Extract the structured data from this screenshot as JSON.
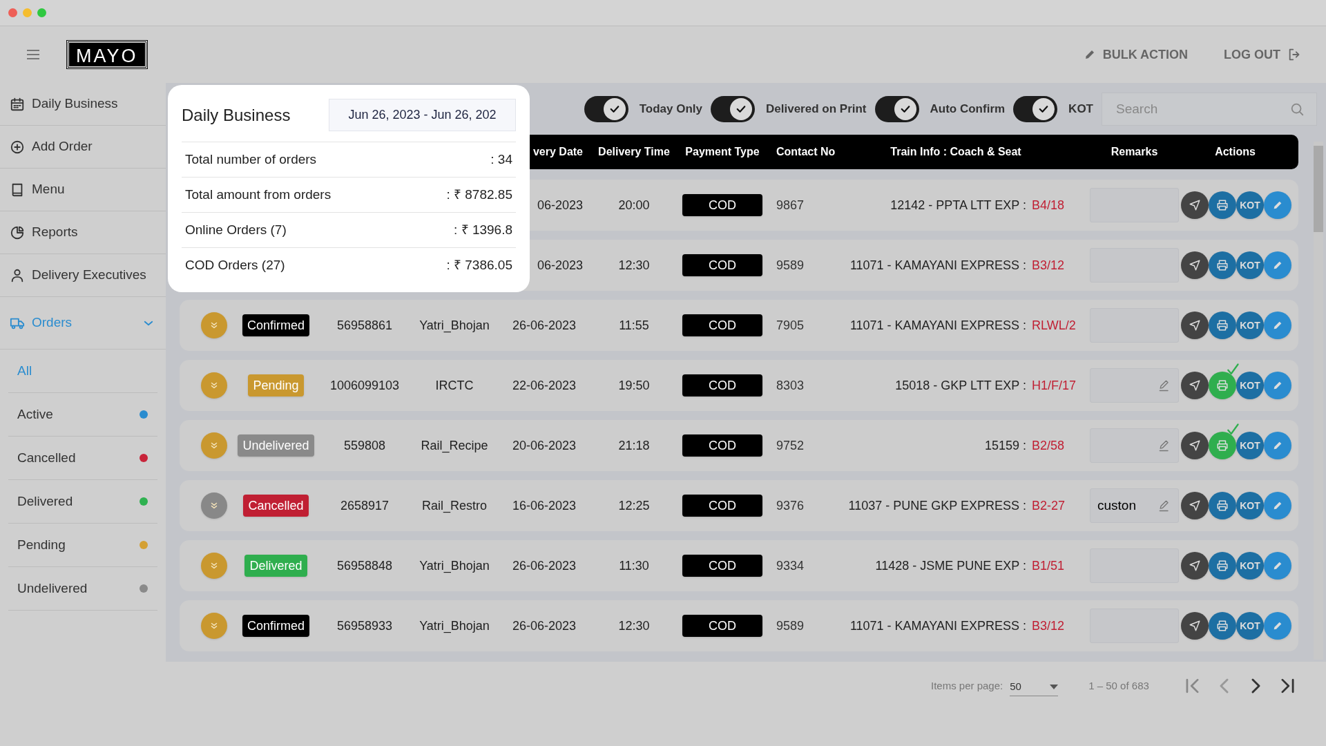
{
  "header": {
    "logo": "MAYO",
    "actions": [
      "BULK ACTION",
      "LOG OUT"
    ]
  },
  "sidebar": {
    "items": [
      {
        "label": "Daily Business",
        "selected": false
      },
      {
        "label": "Add Order",
        "selected": false
      },
      {
        "label": "Menu",
        "selected": false
      },
      {
        "label": "Reports",
        "selected": false
      },
      {
        "label": "Delivery Executives",
        "selected": false
      },
      {
        "label": "Orders",
        "selected": true,
        "expanded": true,
        "children": [
          {
            "label": "All",
            "selected": true
          },
          {
            "label": "Active",
            "selected": false,
            "color": "#2a8ccf"
          },
          {
            "label": "Cancelled",
            "selected": false,
            "color": "#c8243a"
          },
          {
            "label": "Delivered",
            "selected": false,
            "color": "#2fb150"
          },
          {
            "label": "Pending",
            "selected": false,
            "color": "#d4a033"
          },
          {
            "label": "Undelivered",
            "selected": false,
            "color": "#8a8a8a"
          }
        ]
      }
    ]
  },
  "toggles": [
    {
      "label": "Today Only",
      "on": true
    },
    {
      "label": "Delivered on Print",
      "on": true
    },
    {
      "label": "Auto Confirm",
      "on": true
    },
    {
      "label": "KOT",
      "on": true
    }
  ],
  "search": {
    "placeholder": "Search"
  },
  "table": {
    "columns": [
      "very Date",
      "Delivery Time",
      "Payment Type",
      "Contact No",
      "Train Info : Coach & Seat",
      "Remarks",
      "Actions"
    ],
    "rows": [
      {
        "date": "06-2023",
        "time": "20:00",
        "payment": "COD",
        "contact": "9867",
        "train": "12142 - PPTA LTT EXP :",
        "seat": "B4/18",
        "remark_edit_icon": false,
        "printed": false,
        "kot": "KOT"
      },
      {
        "date": "06-2023",
        "time": "12:30",
        "payment": "COD",
        "contact": "9589",
        "train": "11071 - KAMAYANI EXPRESS :",
        "seat": "B3/12",
        "remark_edit_icon": false,
        "printed": false,
        "kot": "KOT"
      },
      {
        "expand_enabled": true,
        "status": {
          "label": "Confirmed",
          "color": "#000000"
        },
        "order_id": "56958861",
        "vendor": "Yatri_Bhojan",
        "date": "26-06-2023",
        "time": "11:55",
        "payment": "COD",
        "contact": "7905",
        "train": "11071 - KAMAYANI EXPRESS :",
        "seat": "RLWL/2",
        "remark_edit_icon": false,
        "printed": false,
        "kot": "KOT"
      },
      {
        "expand_enabled": true,
        "status": {
          "label": "Pending",
          "color": "#c9982f"
        },
        "order_id": "1006099103",
        "vendor": "IRCTC",
        "date": "22-06-2023",
        "time": "19:50",
        "payment": "COD",
        "contact": "8303",
        "train": "15018 - GKP LTT EXP :",
        "seat": "H1/F/17",
        "remark_edit_icon": true,
        "printed": true,
        "kot": "KOT"
      },
      {
        "expand_enabled": true,
        "status": {
          "label": "Undelivered",
          "color": "#8a8a8a"
        },
        "order_id": "559808",
        "vendor": "Rail_Recipe",
        "date": "20-06-2023",
        "time": "21:18",
        "payment": "COD",
        "contact": "9752",
        "train": "15159 :",
        "seat": "B2/58",
        "remark_edit_icon": true,
        "printed": true,
        "kot": "KOT"
      },
      {
        "expand_enabled": false,
        "status": {
          "label": "Cancelled",
          "color": "#c01f33"
        },
        "order_id": "2658917",
        "vendor": "Rail_Restro",
        "date": "16-06-2023",
        "time": "12:25",
        "payment": "COD",
        "contact": "9376",
        "train": "11037 - PUNE GKP EXPRESS :",
        "seat": "B2-27",
        "remark": "custon",
        "remark_edit_icon": true,
        "printed": false,
        "kot": "KOT"
      },
      {
        "expand_enabled": true,
        "status": {
          "label": "Delivered",
          "color": "#2fae4e"
        },
        "order_id": "56958848",
        "vendor": "Yatri_Bhojan",
        "date": "26-06-2023",
        "time": "11:30",
        "payment": "COD",
        "contact": "9334",
        "train": "11428 - JSME PUNE EXP :",
        "seat": "B1/51",
        "remark_edit_icon": false,
        "printed": false,
        "kot": "KOT"
      },
      {
        "expand_enabled": true,
        "status": {
          "label": "Confirmed",
          "color": "#000000"
        },
        "order_id": "56958933",
        "vendor": "Yatri_Bhojan",
        "date": "26-06-2023",
        "time": "12:30",
        "payment": "COD",
        "contact": "9589",
        "train": "11071 - KAMAYANI EXPRESS :",
        "seat": "B3/12",
        "remark_edit_icon": false,
        "printed": false,
        "kot": "KOT"
      }
    ]
  },
  "pagination": {
    "label": "Items per page:",
    "page_size": "50",
    "range": "1 – 50 of 683"
  },
  "popup": {
    "title": "Daily Business",
    "date_range": "Jun 26, 2023 - Jun 26, 202",
    "rows": [
      {
        "label": "Total number of orders",
        "value": ": 34"
      },
      {
        "label": "Total amount from orders",
        "value": ": ₹ 8782.85"
      },
      {
        "label": "Online Orders (7)",
        "value": ": ₹ 1396.8"
      },
      {
        "label": "COD Orders (27)",
        "value": ": ₹ 7386.05"
      }
    ]
  }
}
